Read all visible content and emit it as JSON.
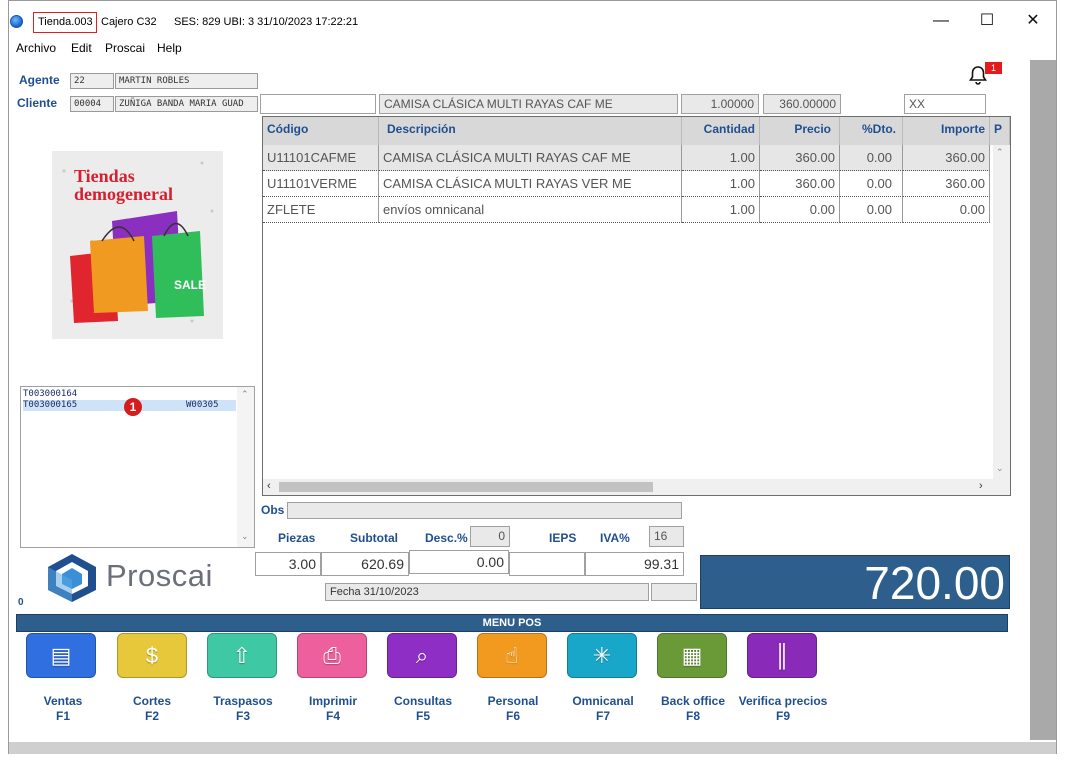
{
  "titlebar": {
    "tienda": "Tienda.003",
    "cajero": "Cajero C32",
    "session": "SES: 829  UBI: 3  31/10/2023 17:22:21",
    "minimize": "—",
    "maximize": "☐",
    "close": "✕"
  },
  "menu": [
    "Archivo",
    "Edit",
    "Proscai",
    "Help"
  ],
  "agente": {
    "label": "Agente",
    "code": "22",
    "name": "MARTIN ROBLES"
  },
  "cliente": {
    "label": "Cliente",
    "code": "00004",
    "name": "ZUÑIGA BANDA MARIA GUAD"
  },
  "notification": {
    "icon": "bell-icon",
    "badge": "1"
  },
  "product_entry": {
    "search": "",
    "description": "CAMISA CLÁSICA MULTI RAYAS CAF ME",
    "quantity": "1.00000",
    "price": "360.00000",
    "code": "XX"
  },
  "promo": {
    "line1": "Tiendas",
    "line2": "demogeneral",
    "sale": "SALE"
  },
  "grid": {
    "headers": [
      "Código",
      "Descripción",
      "Cantidad",
      "Precio",
      "%Dto.",
      "Importe",
      "P"
    ],
    "rows": [
      [
        "U11101CAFME",
        "CAMISA CLÁSICA MULTI RAYAS CAF ME",
        "1.00",
        "360.00",
        "0.00",
        "360.00"
      ],
      [
        "U11101VERME",
        "CAMISA CLÁSICA MULTI RAYAS VER ME",
        "1.00",
        "360.00",
        "0.00",
        "360.00"
      ],
      [
        "ZFLETE",
        "envíos omnicanal",
        "1.00",
        "0.00",
        "0.00",
        "0.00"
      ]
    ]
  },
  "tickets": [
    {
      "id": "T003000164",
      "code": ""
    },
    {
      "id": "T003000165",
      "code": "W00305"
    }
  ],
  "ticket_marker": "1",
  "obs": {
    "label": "Obs",
    "value": ""
  },
  "totals": {
    "labels": [
      "Piezas",
      "Subtotal",
      "Desc.%",
      "IEPS",
      "IVA%"
    ],
    "desc_pct": "0",
    "iva_pct": "16",
    "piezas": "3.00",
    "subtotal": "620.69",
    "descuento": "0.00",
    "ieps": "",
    "iva": "99.31",
    "fecha": "Fecha 31/10/2023",
    "grand_total": "720.00"
  },
  "brand": {
    "name": "Proscai",
    "counter": "0"
  },
  "menu_pos": {
    "title": "MENU POS",
    "buttons": [
      {
        "label": "Ventas",
        "key": "F1",
        "icon": "ventas-icon",
        "color": "#2f6fe0",
        "glyph": "▤"
      },
      {
        "label": "Cortes",
        "key": "F2",
        "icon": "cortes-icon",
        "color": "#e7c83a",
        "glyph": "$"
      },
      {
        "label": "Traspasos",
        "key": "F3",
        "icon": "traspasos-icon",
        "color": "#3fc8a4",
        "glyph": "⇧"
      },
      {
        "label": "Imprimir",
        "key": "F4",
        "icon": "printer-icon",
        "color": "#ee5f9e",
        "glyph": "⎙"
      },
      {
        "label": "Consultas",
        "key": "F5",
        "icon": "magnifier-icon",
        "color": "#8e2ec4",
        "glyph": "⌕"
      },
      {
        "label": "Personal",
        "key": "F6",
        "icon": "touch-icon",
        "color": "#f29a1f",
        "glyph": "☝"
      },
      {
        "label": "Omnicanal",
        "key": "F7",
        "icon": "network-icon",
        "color": "#19a7c9",
        "glyph": "✳"
      },
      {
        "label": "Back office",
        "key": "F8",
        "icon": "building-icon",
        "color": "#6a9a38",
        "glyph": "▦"
      },
      {
        "label": "Verifica precios",
        "key": "F9",
        "icon": "barcode-icon",
        "color": "#8a2ab8",
        "glyph": "║"
      }
    ]
  }
}
